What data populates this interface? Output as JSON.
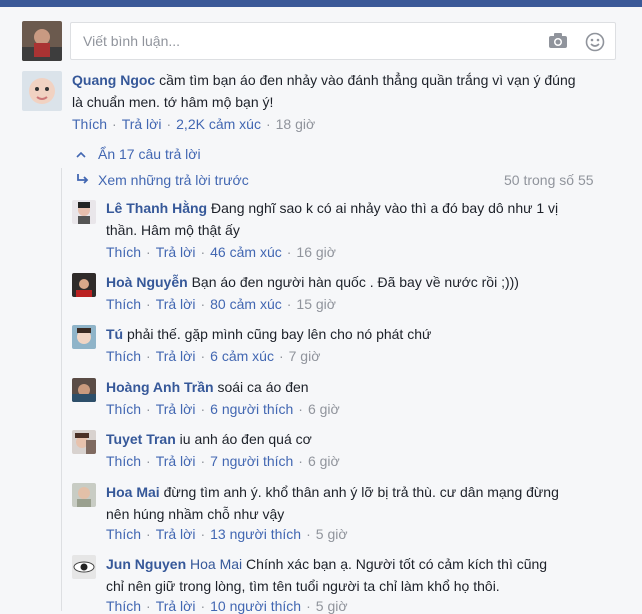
{
  "composer": {
    "placeholder": "Viết bình luận...",
    "camera_icon": "camera-icon",
    "emoji_icon": "smiley-icon"
  },
  "main_comment": {
    "author": "Quang Ngoc",
    "text": " cầm tìm bạn áo đen nhảy vào đánh thẳng quần trắng vì vạn ý đúng",
    "text2": "là chuẩn men. tớ hâm mộ bạn ý!",
    "like": "Thích",
    "reply": "Trả lời",
    "reactions": "2,2K cảm xúc",
    "time": "18 giờ"
  },
  "thread": {
    "hide_label": "Ẩn 17 câu trả lời",
    "previous_label": "Xem những trả lời trước",
    "count_label": "50 trong số 55"
  },
  "replies": [
    {
      "author": "Lê Thanh Hằng",
      "text": " Đang nghĩ sao k có ai nhảy vào thì a đó bay dô như 1 vị",
      "text2": "thần. Hâm mộ thật ấy",
      "like": "Thích",
      "reply": "Trả lời",
      "reactions": "46 cảm xúc",
      "time": "16 giờ"
    },
    {
      "author": "Hoà Nguyễn",
      "text": " Bạn áo đen người hàn quốc . Đã bay về nước rồi ;)))",
      "like": "Thích",
      "reply": "Trả lời",
      "reactions": "80 cảm xúc",
      "time": "15 giờ"
    },
    {
      "author": "Tú",
      "text": " phải thế. gặp mình cũng bay lên cho nó phát chứ",
      "like": "Thích",
      "reply": "Trả lời",
      "reactions": "6 cảm xúc",
      "time": "7 giờ"
    },
    {
      "author": "Hoàng Anh Trần",
      "text": " soái ca áo đen",
      "like": "Thích",
      "reply": "Trả lời",
      "reactions": "6 người thích",
      "time": "6 giờ"
    },
    {
      "author": "Tuyet Tran",
      "text": " iu anh áo đen quá cơ",
      "like": "Thích",
      "reply": "Trả lời",
      "reactions": "7 người thích",
      "time": "6 giờ"
    },
    {
      "author": "Hoa Mai",
      "text": " đừng tìm anh ý. khổ thân anh ý lỡ bị trả thù. cư dân mạng đừng",
      "text2": "nên húng nhầm chỗ như vậy",
      "like": "Thích",
      "reply": "Trả lời",
      "reactions": "13 người thích",
      "time": "5 giờ"
    },
    {
      "author": "Jun Nguyen",
      "mention": "Hoa Mai",
      "text": " Chính xác bạn ạ. Người tốt có cảm kích thì cũng",
      "text2": "chỉ nên giữ trong lòng, tìm tên tuổi người ta chỉ làm khổ họ thôi.",
      "like": "Thích",
      "reply": "Trả lời",
      "reactions": "10 người thích",
      "time": "5 giờ"
    }
  ]
}
